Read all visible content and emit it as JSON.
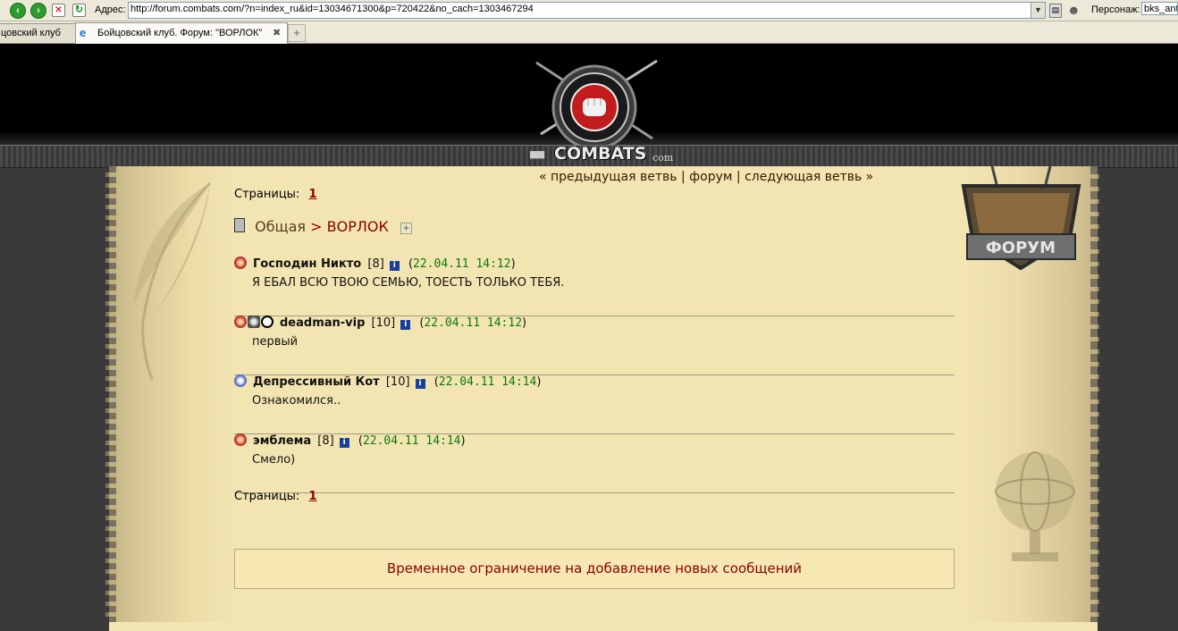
{
  "browser": {
    "address_label": "Адрес:",
    "url": "http://forum.combats.com/?n=index_ru&id=13034671300&p=720422&no_cach=1303467294",
    "person_label": "Персонаж:",
    "person_value": "bks_ant",
    "tabs": [
      {
        "label": "цовский клуб"
      },
      {
        "label": "Бойцовский клуб. Форум: \"ВОРЛОК\""
      }
    ]
  },
  "header": {
    "logo_text": "COMBATS",
    "logo_suffix": "com",
    "emblem_text": "ФОРУМ"
  },
  "nav": {
    "prev": "« предыдущая ветвь",
    "sep1": "|",
    "forum": "форум",
    "sep2": "|",
    "next": "следующая ветвь »"
  },
  "pages": {
    "label": "Страницы:",
    "current": "1"
  },
  "breadcrumb": {
    "section": "Общая",
    "separator": ">",
    "topic": "ВОРЛОК"
  },
  "posts": [
    {
      "author": "Господин Никто",
      "level": "[8]",
      "date": "22.04.11 14:12",
      "text": "Я ЕБАЛ ВСЮ ТВОЮ СЕМЬЮ, ТОЕСТЬ ТОЛЬКО ТЕБЯ."
    },
    {
      "author": "deadman-vip",
      "level": "[10]",
      "date": "22.04.11 14:12",
      "text": "первый"
    },
    {
      "author": "Депрессивный Кот",
      "level": "[10]",
      "date": "22.04.11 14:14",
      "text": "Ознакомился.."
    },
    {
      "author": "эмблема",
      "level": "[8]",
      "date": "22.04.11 14:14",
      "text": "Смело)"
    }
  ],
  "restriction_text": "Временное ограничение на добавление новых сообщений"
}
